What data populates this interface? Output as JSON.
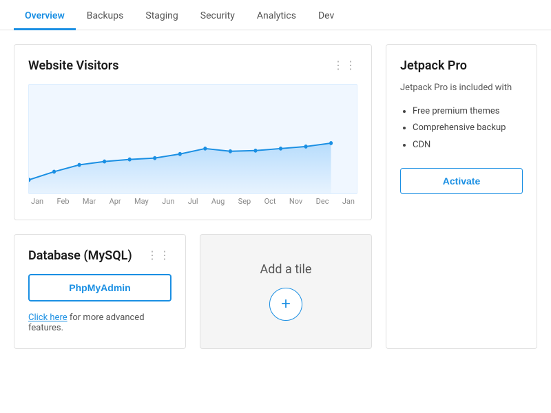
{
  "nav": {
    "tabs": [
      {
        "label": "Overview",
        "active": true
      },
      {
        "label": "Backups",
        "active": false
      },
      {
        "label": "Staging",
        "active": false
      },
      {
        "label": "Security",
        "active": false
      },
      {
        "label": "Analytics",
        "active": false
      },
      {
        "label": "Dev",
        "active": false
      }
    ]
  },
  "visitors_card": {
    "title": "Website Visitors",
    "months": [
      "Jan",
      "Feb",
      "Mar",
      "Apr",
      "May",
      "Jun",
      "Jul",
      "Aug",
      "Sep",
      "Oct",
      "Nov",
      "Dec",
      "Jan"
    ],
    "data_points": [
      10,
      18,
      22,
      25,
      27,
      28,
      32,
      38,
      35,
      36,
      38,
      40,
      45
    ]
  },
  "database_card": {
    "title": "Database (MySQL)",
    "phpmyadmin_label": "PhpMyAdmin",
    "link_text": "Click here",
    "link_suffix": " for more advanced features."
  },
  "add_tile": {
    "label": "Add a tile",
    "icon": "+"
  },
  "jetpack_card": {
    "title": "Jetpack Pro",
    "description": "Jetpack Pro is included with",
    "features": [
      "Free premium themes",
      "Comprehensive backup",
      "CDN"
    ],
    "activate_label": "Activate"
  }
}
